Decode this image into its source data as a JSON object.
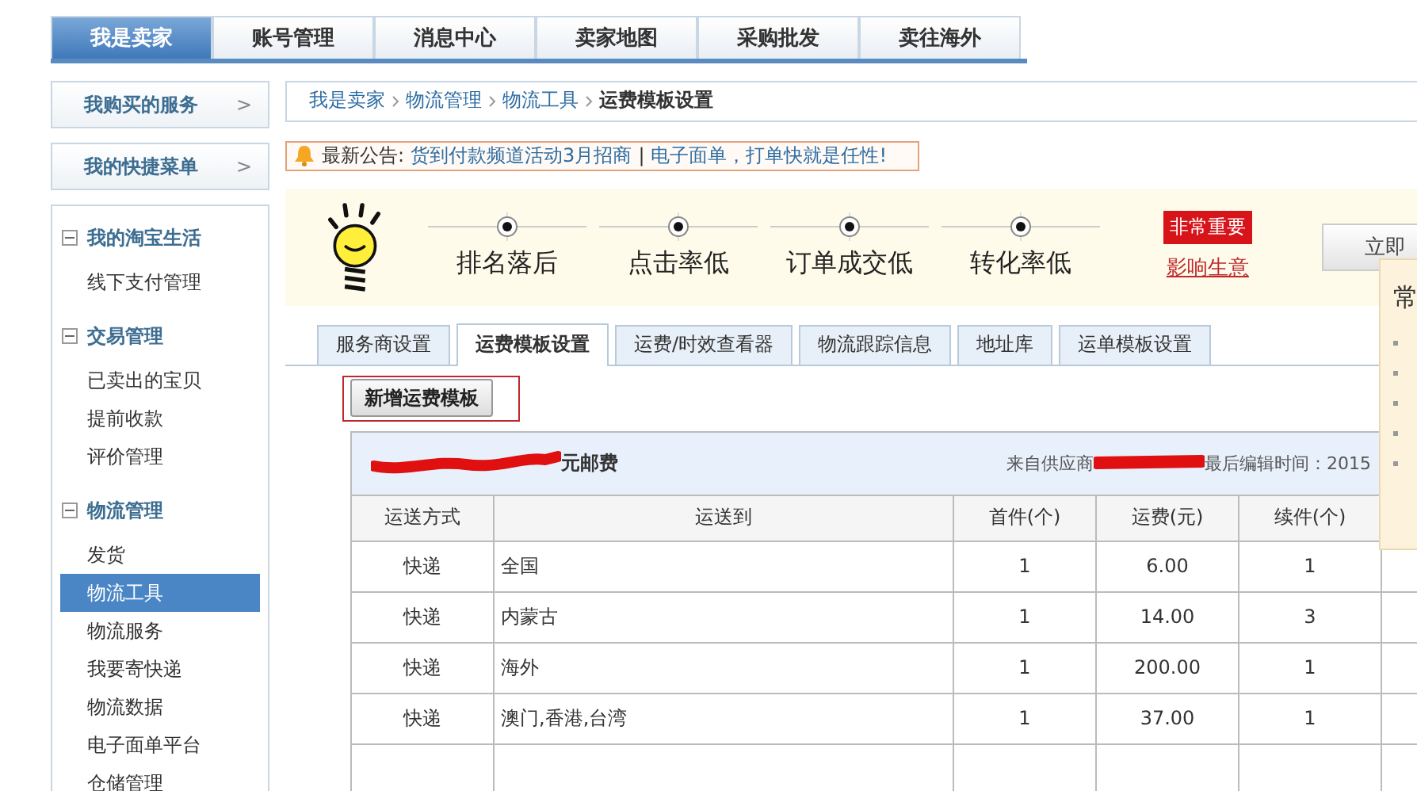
{
  "top_nav": [
    {
      "label": "我是卖家",
      "selected": true
    },
    {
      "label": "账号管理",
      "selected": false
    },
    {
      "label": "消息中心",
      "selected": false
    },
    {
      "label": "卖家地图",
      "selected": false
    },
    {
      "label": "采购批发",
      "selected": false
    },
    {
      "label": "卖往海外",
      "selected": false
    }
  ],
  "sidebar": {
    "shortcuts": [
      {
        "label": "我购买的服务",
        "arrow": ">"
      },
      {
        "label": "我的快捷菜单",
        "arrow": ">"
      }
    ],
    "groups": [
      {
        "title": "我的淘宝生活",
        "expanded": true,
        "items": [
          {
            "label": "线下支付管理",
            "selected": false
          }
        ]
      },
      {
        "title": "交易管理",
        "expanded": true,
        "items": [
          {
            "label": "已卖出的宝贝",
            "selected": false
          },
          {
            "label": "提前收款",
            "selected": false
          },
          {
            "label": "评价管理",
            "selected": false
          }
        ]
      },
      {
        "title": "物流管理",
        "expanded": true,
        "items": [
          {
            "label": "发货",
            "selected": false
          },
          {
            "label": "物流工具",
            "selected": true
          },
          {
            "label": "物流服务",
            "selected": false
          },
          {
            "label": "我要寄快递",
            "selected": false
          },
          {
            "label": "物流数据",
            "selected": false
          },
          {
            "label": "电子面单平台",
            "selected": false
          },
          {
            "label": "仓储管理",
            "selected": false
          }
        ]
      }
    ]
  },
  "breadcrumb": [
    {
      "label": "我是卖家",
      "kind": "link"
    },
    {
      "label": "物流管理",
      "kind": "link"
    },
    {
      "label": "物流工具",
      "kind": "link"
    },
    {
      "label": "运费模板设置",
      "kind": "current"
    }
  ],
  "notice": {
    "label": "最新公告:",
    "links": [
      "货到付款频道活动3月招商",
      "电子面单，打单快就是任性!"
    ],
    "separator": "|"
  },
  "banner": {
    "steps": [
      "排名落后",
      "点击率低",
      "订单成交低",
      "转化率低"
    ],
    "badge": "非常重要",
    "link": "影响生意",
    "button": "立即"
  },
  "popup": {
    "title": "常"
  },
  "tabs": [
    {
      "label": "服务商设置",
      "selected": false
    },
    {
      "label": "运费模板设置",
      "selected": true
    },
    {
      "label": "运费/时效查看器",
      "selected": false
    },
    {
      "label": "物流跟踪信息",
      "selected": false
    },
    {
      "label": "地址库",
      "selected": false
    },
    {
      "label": "运单模板设置",
      "selected": false
    }
  ],
  "add_button": "新增运费模板",
  "template": {
    "title": "元邮费",
    "source_label": "来自供应商",
    "edited": "最后编辑时间：2015",
    "columns": [
      "运送方式",
      "运送到",
      "首件(个)",
      "运费(元)",
      "续件(个)"
    ],
    "rows": [
      [
        "快递",
        "全国",
        "1",
        "6.00",
        "1"
      ],
      [
        "快递",
        "内蒙古",
        "1",
        "14.00",
        "3"
      ],
      [
        "快递",
        "海外",
        "1",
        "200.00",
        "1"
      ],
      [
        "快递",
        "澳门,香港,台湾",
        "1",
        "37.00",
        "1"
      ]
    ]
  }
}
